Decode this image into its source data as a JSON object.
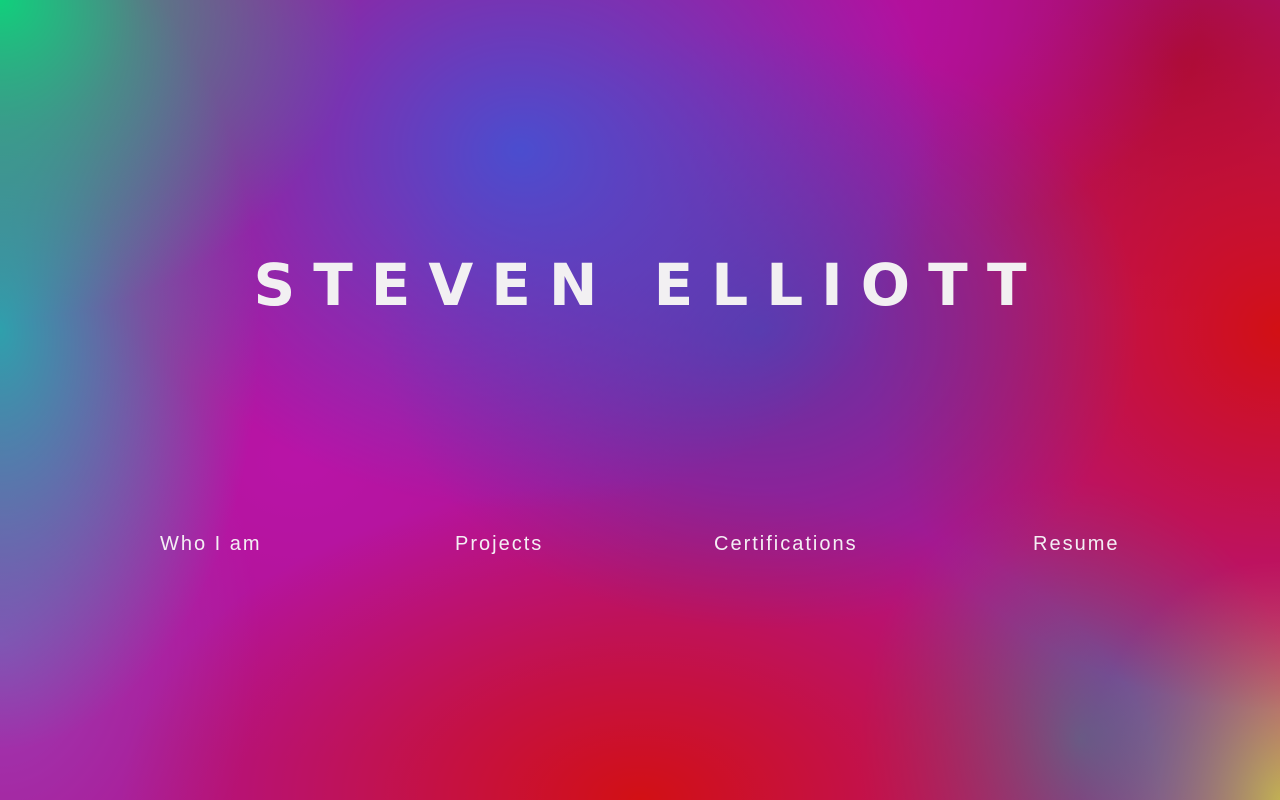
{
  "hero": {
    "title": "STEVEN ELLIOTT"
  },
  "nav": {
    "items": [
      {
        "label": "Who I am"
      },
      {
        "label": "Projects"
      },
      {
        "label": "Certifications"
      },
      {
        "label": "Resume"
      }
    ]
  },
  "colors": {
    "text": "#f2f0f2",
    "gradient_top_left": "#10d07c",
    "gradient_blue": "#4650d2",
    "gradient_magenta": "#b0138f",
    "gradient_red": "#d21014",
    "gradient_bottom_right": "#c8b450"
  }
}
